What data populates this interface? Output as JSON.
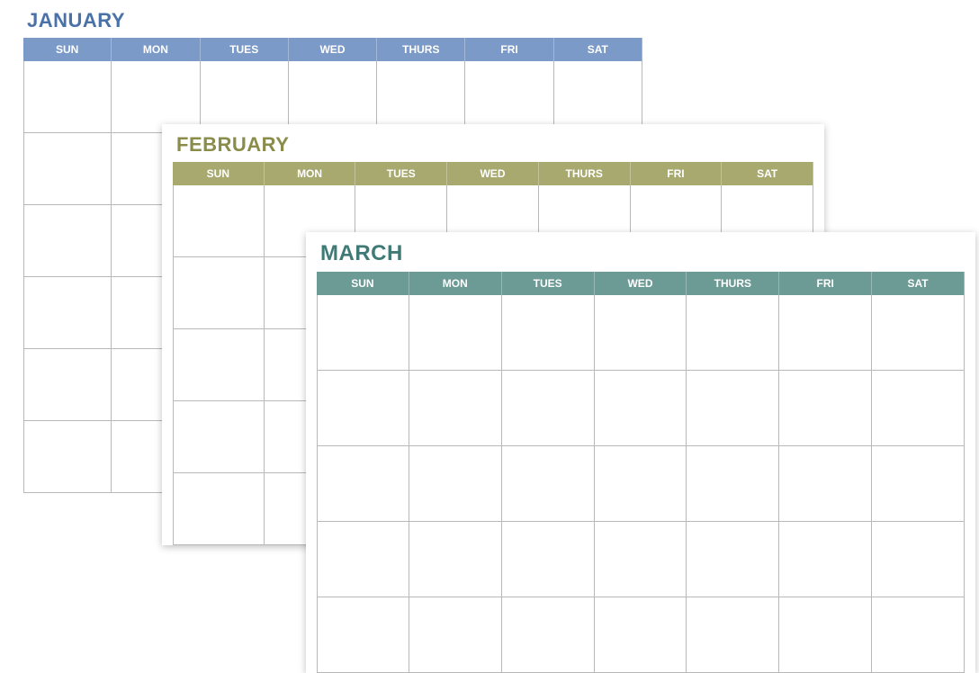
{
  "days": [
    "SUN",
    "MON",
    "TUES",
    "WED",
    "THURS",
    "FRI",
    "SAT"
  ],
  "calendars": {
    "jan": {
      "title": "JANUARY",
      "rows": 6,
      "title_color": "#4a72a8",
      "header_bg": "#7b9ac7"
    },
    "feb": {
      "title": "FEBRUARY",
      "rows": 5,
      "title_color": "#8a8c4a",
      "header_bg": "#a7a96f"
    },
    "mar": {
      "title": "MARCH",
      "rows": 5,
      "title_color": "#3f7a76",
      "header_bg": "#6c9a95"
    }
  }
}
